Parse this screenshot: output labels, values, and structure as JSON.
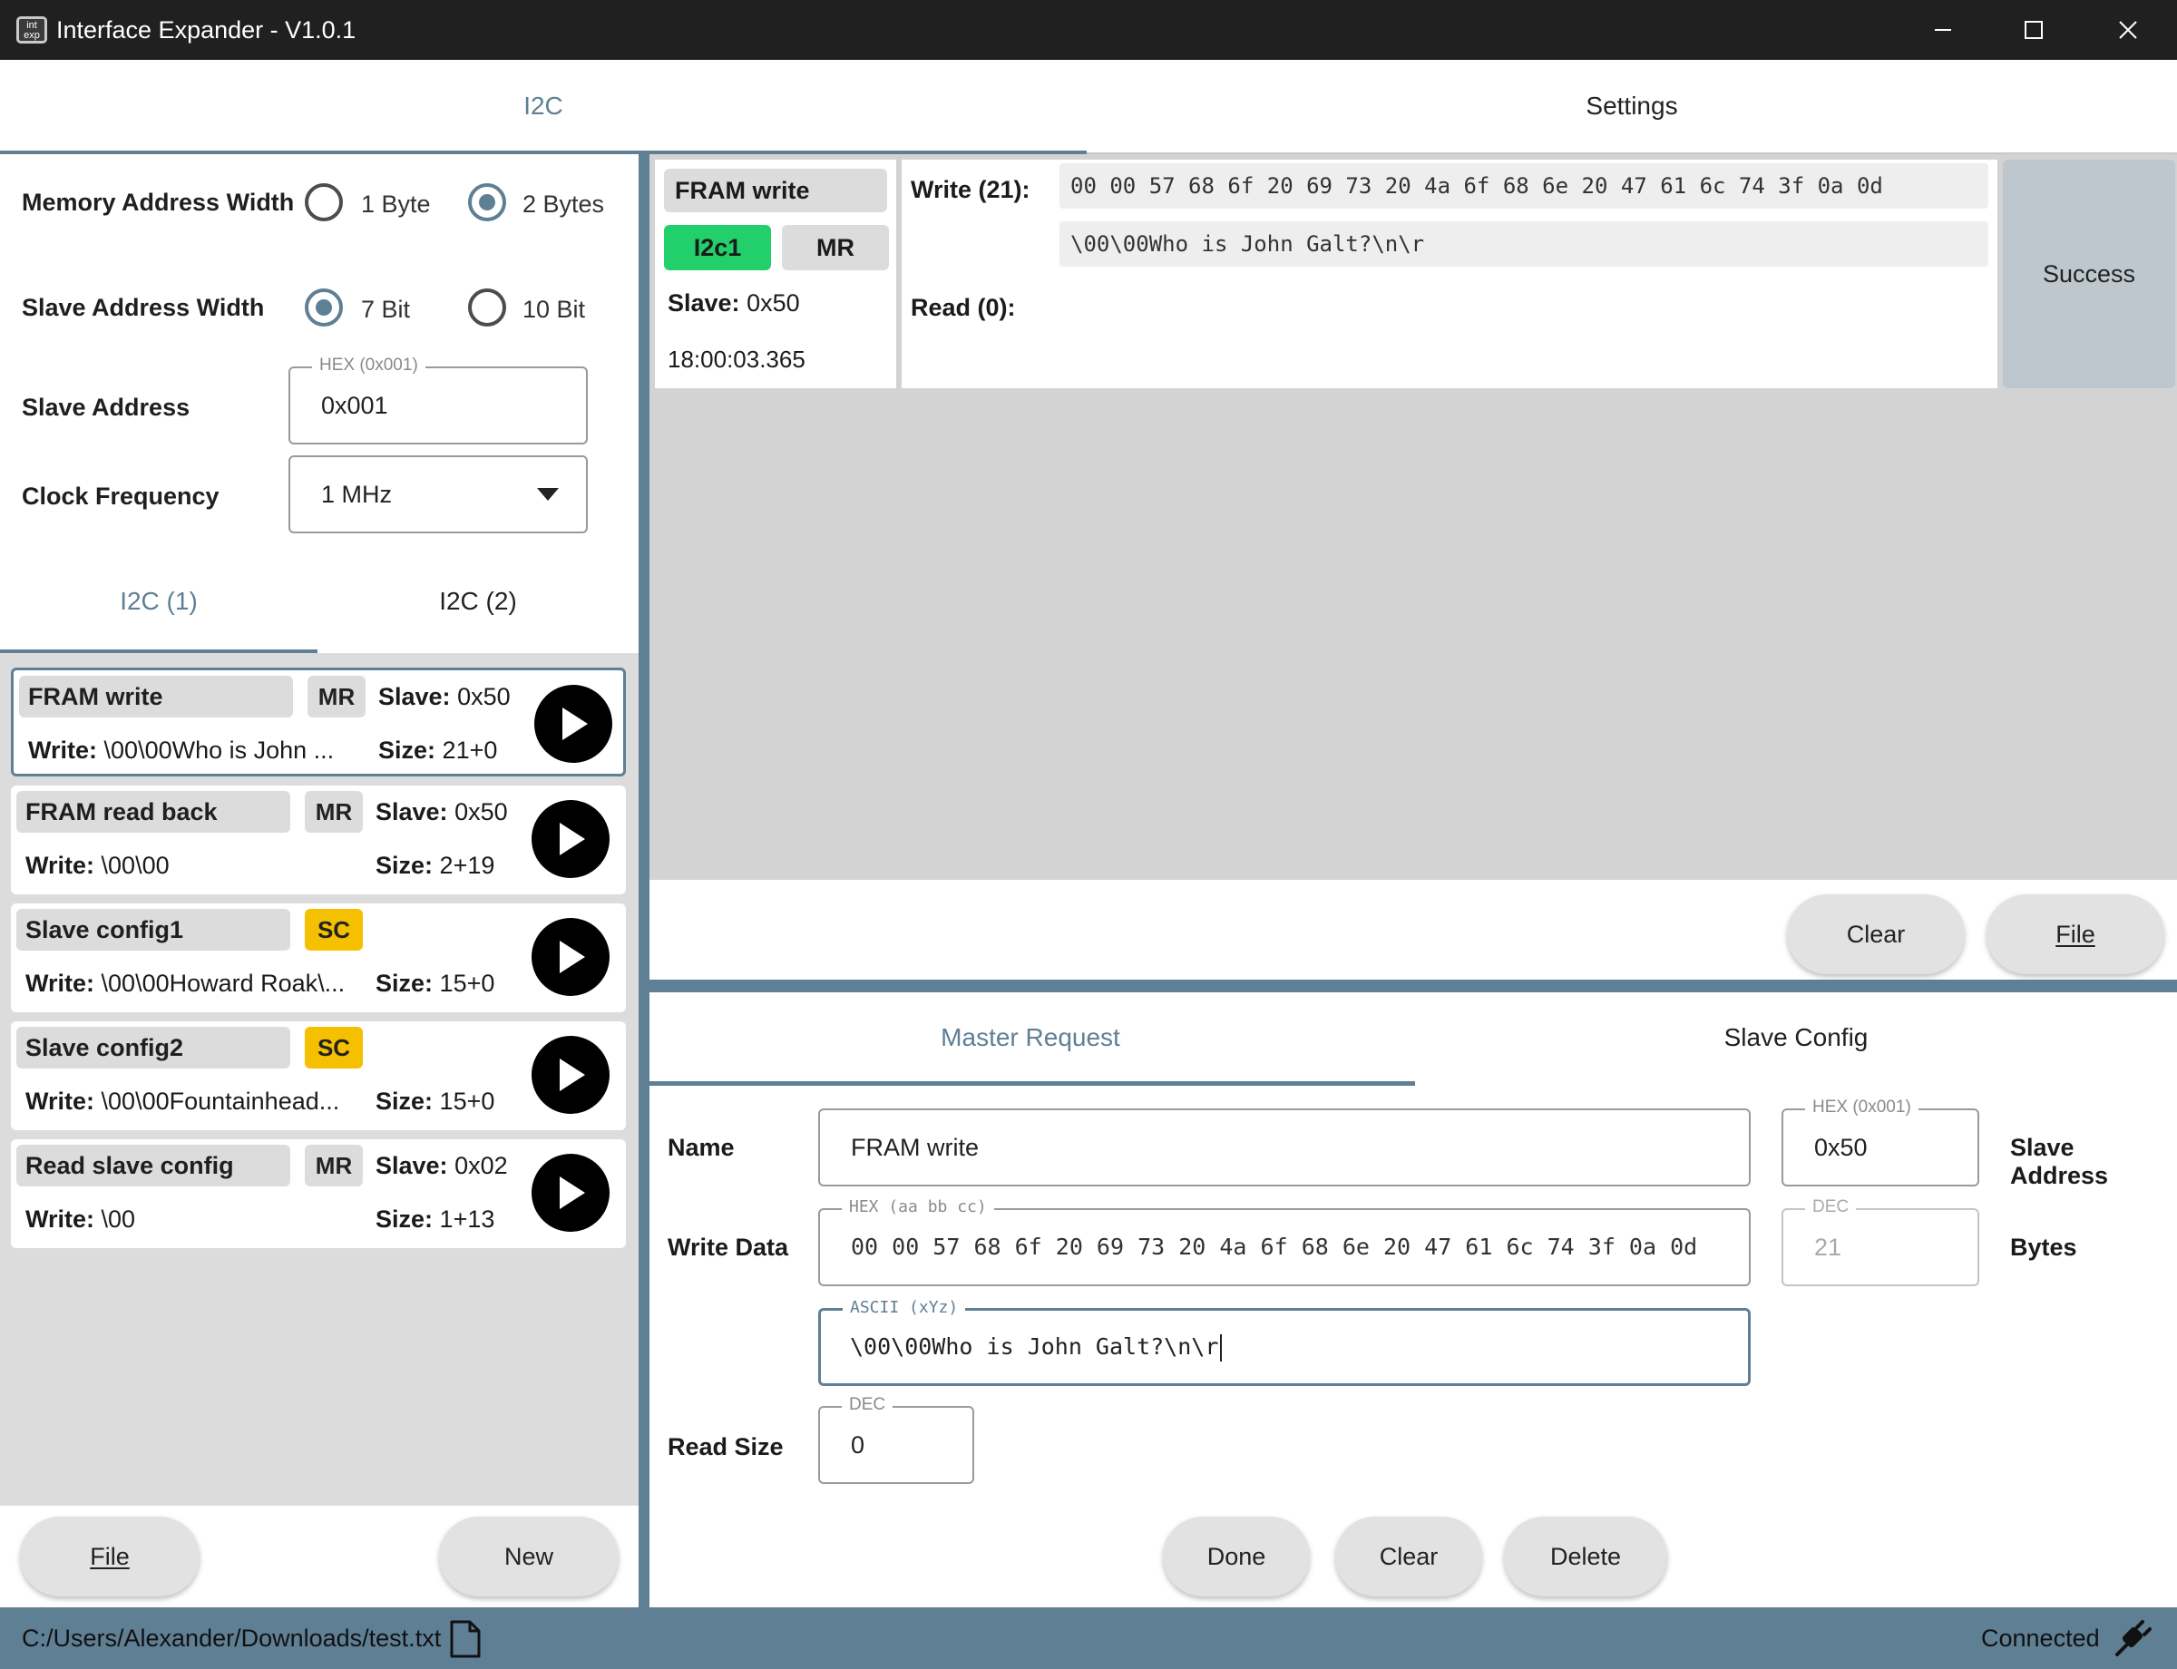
{
  "window": {
    "title": "Interface Expander - V1.0.1",
    "icon_text": "int exp"
  },
  "top_tabs": {
    "i2c": "I2C",
    "settings": "Settings",
    "selected": "i2c"
  },
  "config": {
    "mem_addr_width": {
      "label": "Memory Address Width",
      "option1": "1 Byte",
      "option2": "2 Bytes",
      "selected": "2 Bytes"
    },
    "slave_addr_width": {
      "label": "Slave Address Width",
      "option1": "7 Bit",
      "option2": "10 Bit",
      "selected": "7 Bit"
    },
    "slave_address": {
      "label": "Slave Address",
      "legend": "HEX (0x001)",
      "value": "0x001"
    },
    "clock_frequency": {
      "label": "Clock Frequency",
      "value": "1 MHz"
    }
  },
  "sub_tabs": {
    "tab1": "I2C (1)",
    "tab2": "I2C (2)",
    "selected": "tab1"
  },
  "requests": [
    {
      "name": "FRAM write",
      "badge": "MR",
      "slave_label": "Slave:",
      "slave": "0x50",
      "write_label": "Write:",
      "write": "\\00\\00Who is John ...",
      "size_label": "Size:",
      "size": "21+0"
    },
    {
      "name": "FRAM read back",
      "badge": "MR",
      "slave_label": "Slave:",
      "slave": "0x50",
      "write_label": "Write:",
      "write": "\\00\\00",
      "size_label": "Size:",
      "size": "2+19"
    },
    {
      "name": "Slave config1",
      "badge": "SC",
      "slave_label": "",
      "slave": "",
      "write_label": "Write:",
      "write": "\\00\\00Howard Roak\\...",
      "size_label": "Size:",
      "size": "15+0"
    },
    {
      "name": "Slave config2",
      "badge": "SC",
      "slave_label": "",
      "slave": "",
      "write_label": "Write:",
      "write": "\\00\\00Fountainhead...",
      "size_label": "Size:",
      "size": "15+0"
    },
    {
      "name": "Read slave config",
      "badge": "MR",
      "slave_label": "Slave:",
      "slave": "0x02",
      "write_label": "Write:",
      "write": "\\00",
      "size_label": "Size:",
      "size": "1+13"
    }
  ],
  "left_buttons": {
    "file": "File",
    "new": "New"
  },
  "log": {
    "name": "FRAM write",
    "bus": "I2c1",
    "type": "MR",
    "slave_label": "Slave:",
    "slave": "0x50",
    "time": "18:00:03.365",
    "write_label": "Write (21):",
    "write_hex": "00 00 57 68 6f 20 69 73 20 4a 6f 68 6e 20 47 61 6c 74 3f 0a 0d",
    "write_ascii": "\\00\\00Who is John Galt?\\n\\r",
    "read_label": "Read (0):",
    "status": "Success"
  },
  "log_buttons": {
    "clear": "Clear",
    "file": "File"
  },
  "editor_tabs": {
    "master_request": "Master Request",
    "slave_config": "Slave Config",
    "selected": "master_request"
  },
  "editor": {
    "name_label": "Name",
    "name_value": "FRAM write",
    "slave_addr_legend": "HEX (0x001)",
    "slave_addr_value": "0x50",
    "slave_addr_label": "Slave Address",
    "write_data_label": "Write Data",
    "hex_legend": "HEX (aa bb cc)",
    "hex_value": "00 00 57 68 6f 20 69 73 20 4a 6f 68 6e 20 47 61 6c 74 3f 0a 0d",
    "dec_legend": "DEC",
    "bytes_value": "21",
    "bytes_label": "Bytes",
    "ascii_legend": "ASCII (xYz)",
    "ascii_value": "\\00\\00Who is John Galt?\\n\\r",
    "read_size_label": "Read Size",
    "read_size_legend": "DEC",
    "read_size_value": "0"
  },
  "editor_buttons": {
    "done": "Done",
    "clear": "Clear",
    "delete": "Delete"
  },
  "status_bar": {
    "path": "C:/Users/Alexander/Downloads/test.txt",
    "connection": "Connected"
  },
  "colors": {
    "accent": "#5f7f95",
    "success_bus": "#21d06a",
    "badge_sc": "#f5c000",
    "titlebar": "#202020"
  },
  "icons": {
    "file": "file-icon",
    "plug": "plug-icon",
    "play": "play-icon",
    "dropdown": "chevron-down-icon"
  }
}
